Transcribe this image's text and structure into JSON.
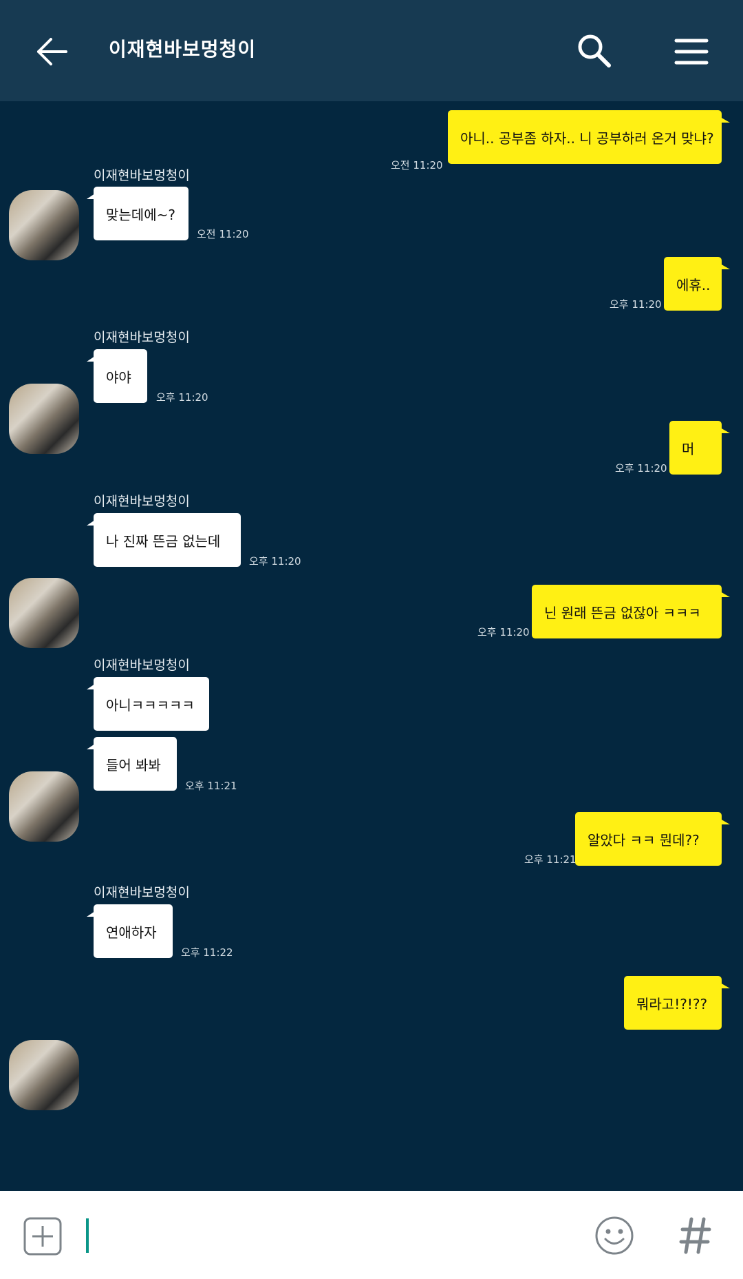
{
  "header": {
    "title": "이재현바보멍청이"
  },
  "chat": {
    "sender_name": "이재현바보멍청이",
    "messages": [
      {
        "side": "out",
        "text": "아니.. 공부좀 하자.. 니 공부하러 온거 맞냐?",
        "time": "오전 11:20"
      },
      {
        "side": "in",
        "text": "맞는데에~?",
        "time": "오전 11:20"
      },
      {
        "side": "out",
        "text": "에휴..",
        "time": "오후 11:20"
      },
      {
        "side": "in",
        "text": "야야",
        "time": "오후 11:20"
      },
      {
        "side": "out",
        "text": "머",
        "time": "오후 11:20"
      },
      {
        "side": "in",
        "text": "나 진짜 뜬금 없는데",
        "time": "오후 11:20"
      },
      {
        "side": "out",
        "text": "닌 원래 뜬금 없잖아 ㅋㅋㅋ",
        "time": "오후 11:20"
      },
      {
        "side": "in",
        "text": "아니ㅋㅋㅋㅋㅋ",
        "time": ""
      },
      {
        "side": "in",
        "text": "들어 봐봐",
        "time": "오후 11:21"
      },
      {
        "side": "out",
        "text": "알았다 ㅋㅋ 뭔데??",
        "time": "오후 11:21"
      },
      {
        "side": "in",
        "text": "연애하자",
        "time": "오후 11:22"
      },
      {
        "side": "out",
        "text": "뭐라고!?!??",
        "time": ""
      }
    ]
  },
  "icons": {
    "back": "arrow-left",
    "search": "magnifier",
    "menu": "hamburger",
    "add": "plus-square",
    "emoji": "smiley",
    "hashtag": "hash"
  },
  "colors": {
    "background": "#04273f",
    "header": "#173a52",
    "incoming_bubble": "#ffffff",
    "outgoing_bubble": "#fff014",
    "cursor": "#0a9688"
  }
}
